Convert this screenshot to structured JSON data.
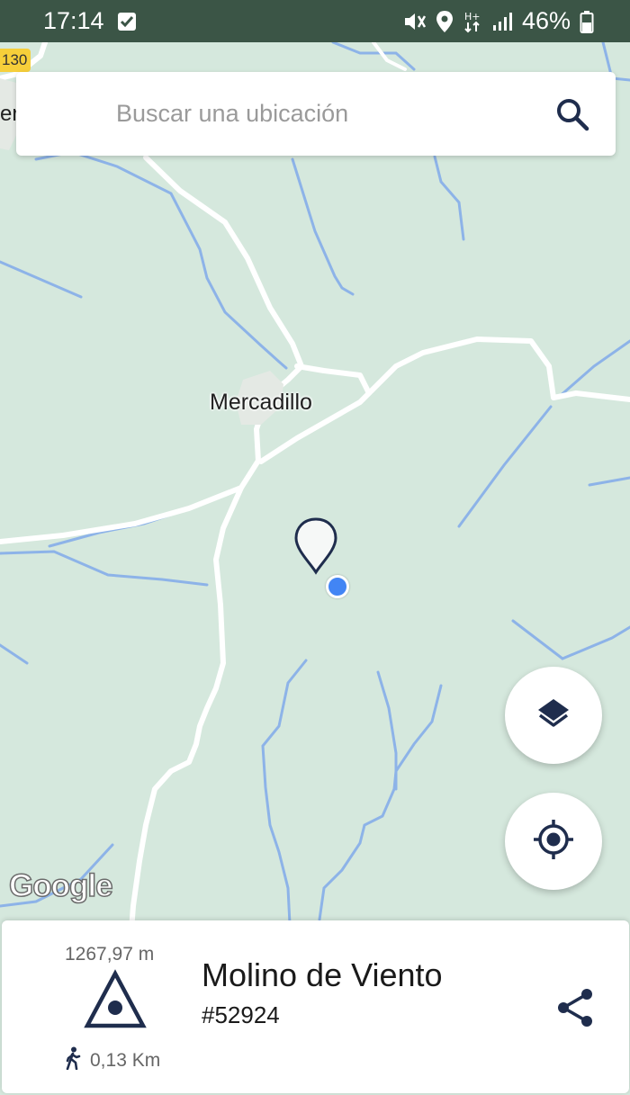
{
  "status_bar": {
    "time": "17:14",
    "battery": "46%",
    "icons": [
      "check-notification-icon",
      "mute-vibrate-icon",
      "location-icon",
      "data-transfer-icon",
      "signal-icon",
      "battery-icon"
    ]
  },
  "search": {
    "placeholder": "Buscar una ubicación",
    "value": "",
    "icon": "search-icon"
  },
  "map": {
    "place_label": "Mercadillo",
    "road_badge": "130",
    "edge_label": "er",
    "attribution": "Google",
    "colors": {
      "land": "#d5e8dd",
      "road": "#ffffff",
      "water": "#8db3e8",
      "user_location": "#4285f4",
      "road_badge": "#f6cf3a"
    }
  },
  "controls": {
    "layers_icon": "layers-icon",
    "locate_icon": "my-location-icon"
  },
  "poi": {
    "elevation": "1267,97 m",
    "distance": "0,13 Km",
    "name": "Molino de Viento",
    "id": "#52924",
    "type_icon": "summit-triangle-icon",
    "accent_color": "#1f2d4d"
  }
}
